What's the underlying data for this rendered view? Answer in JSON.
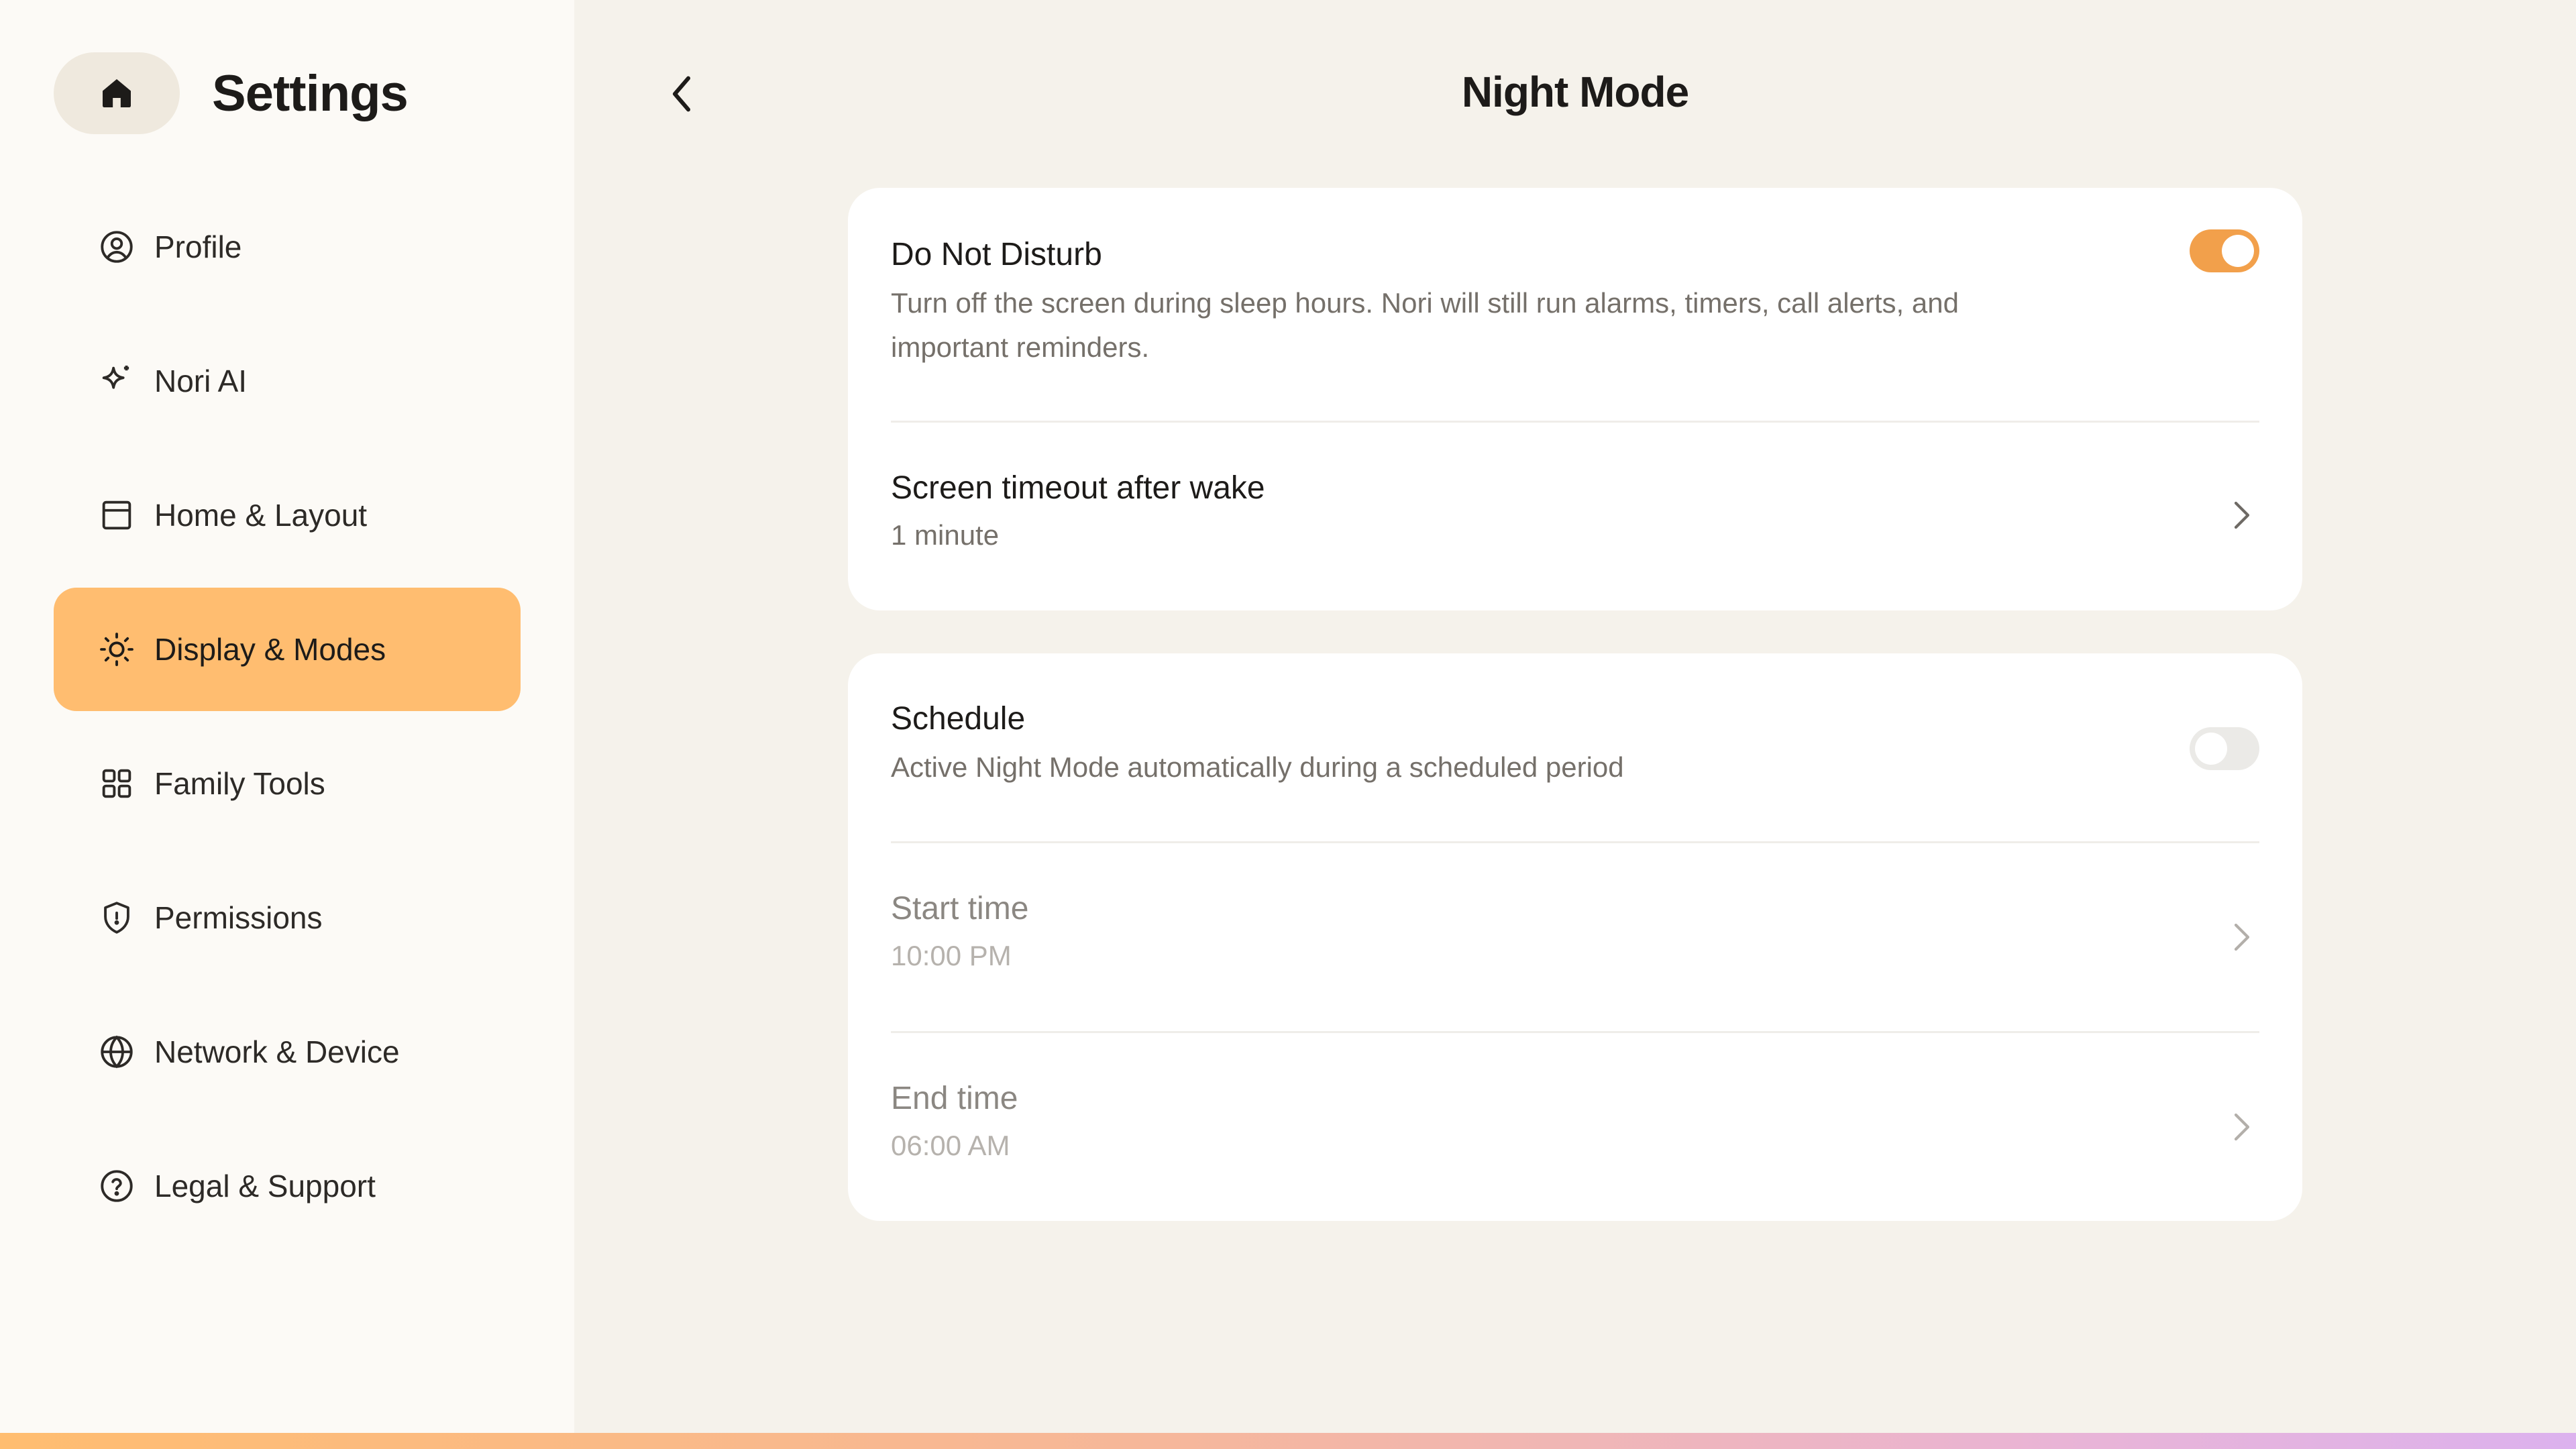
{
  "sidebar": {
    "title": "Settings",
    "home_icon": "home-icon",
    "items": [
      {
        "label": "Profile",
        "icon": "user-circle-icon",
        "active": false
      },
      {
        "label": "Nori AI",
        "icon": "sparkle-icon",
        "active": false
      },
      {
        "label": "Home & Layout",
        "icon": "layout-icon",
        "active": false
      },
      {
        "label": "Display & Modes",
        "icon": "sun-icon",
        "active": true
      },
      {
        "label": "Family Tools",
        "icon": "grid-icon",
        "active": false
      },
      {
        "label": "Permissions",
        "icon": "shield-icon",
        "active": false
      },
      {
        "label": "Network & Device",
        "icon": "globe-icon",
        "active": false
      },
      {
        "label": "Legal & Support",
        "icon": "help-circle-icon",
        "active": false
      }
    ]
  },
  "header": {
    "title": "Night Mode",
    "back_icon": "chevron-left-icon"
  },
  "dnd": {
    "title": "Do Not Disturb",
    "description": "Turn off the screen during sleep hours. Nori will still run alarms, timers, call alerts, and important reminders.",
    "enabled": true
  },
  "timeout": {
    "title": "Screen timeout after wake",
    "value": "1 minute"
  },
  "schedule": {
    "title": "Schedule",
    "description": "Active Night Mode automatically during a scheduled period",
    "enabled": false,
    "start": {
      "title": "Start time",
      "value": "10:00 PM"
    },
    "end": {
      "title": "End time",
      "value": "06:00 AM"
    }
  },
  "colors": {
    "accent": "#f2a04b",
    "active_nav": "#ffbd70",
    "background": "#f5f2eb",
    "sidebar": "#fcfaf6"
  }
}
